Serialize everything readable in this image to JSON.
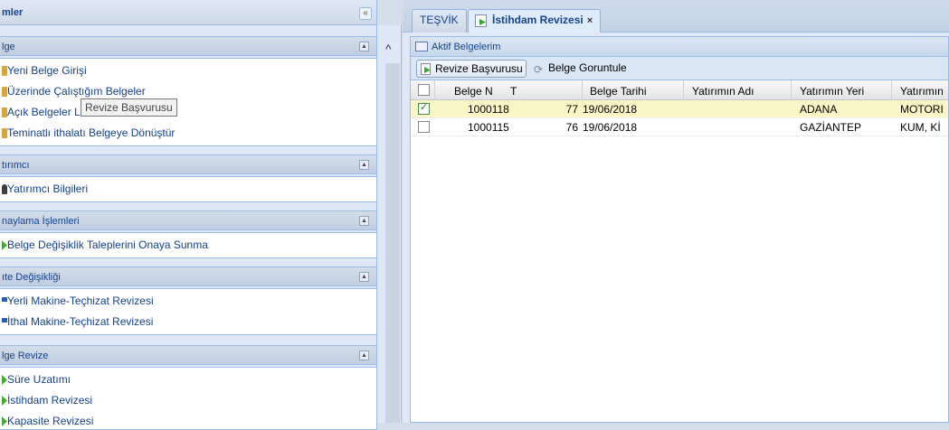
{
  "left_panel": {
    "title": "mler",
    "collapse_icon": "«",
    "groups": [
      {
        "title": "lge",
        "items": [
          {
            "label": "Yeni Belge Girişi",
            "icon": "doc-icon"
          },
          {
            "label": "Üzerinde Çalıştığım Belgeler",
            "icon": "doc-icon"
          },
          {
            "label": "Açık Belgeler Listesi",
            "icon": "doc-icon"
          },
          {
            "label": "Teminatlı ithalatı Belgeye Dönüştür",
            "icon": "doc-icon"
          }
        ]
      },
      {
        "title": "tırımcı",
        "items": [
          {
            "label": "Yatırımcı Bilgileri",
            "icon": "user-icon"
          }
        ]
      },
      {
        "title": "naylama İşlemleri",
        "items": [
          {
            "label": "Belge Değişiklik Taleplerini Onaya Sunma",
            "icon": "green-arrow-icon"
          }
        ]
      },
      {
        "title": "ıte Değişikliği",
        "items": [
          {
            "label": "Yerli Makine-Teçhizat Revizesi",
            "icon": "blue-icon"
          },
          {
            "label": "İthal Makine-Teçhizat Revizesi",
            "icon": "blue-icon"
          }
        ]
      },
      {
        "title": "lge Revize",
        "items": [
          {
            "label": "Süre Uzatımı",
            "icon": "green-arrow-icon"
          },
          {
            "label": "İstihdam Revizesi",
            "icon": "green-arrow-icon"
          },
          {
            "label": "Kapasite Revizesi",
            "icon": "green-arrow-icon"
          }
        ]
      }
    ]
  },
  "tabs": {
    "tesvik": "TEŞVİK",
    "istihdam": "İstihdam Revizesi",
    "close": "×"
  },
  "panel": {
    "title": "Aktif Belgelerim",
    "toolbar": {
      "revize": "Revize Başvurusu",
      "goruntule": "Belge Goruntule"
    },
    "tooltip": "Revize Başvurusu",
    "columns": [
      "Belge N",
      "T",
      "Belge Tarihi",
      "Yatırımın Adı",
      "Yatırımın Yeri",
      "Yatırımın"
    ],
    "rows": [
      {
        "belge": "1000118",
        "no": "77",
        "tarih": "19/06/2018",
        "adi": "",
        "yeri": "ADANA",
        "konu": "MOTORI",
        "checked": true
      },
      {
        "belge": "1000115",
        "no": "76",
        "tarih": "19/06/2018",
        "adi": "",
        "yeri": "GAZİANTEP",
        "konu": "KUM, Kİ",
        "checked": false
      }
    ]
  },
  "colors": {
    "accent": "#15428b",
    "selected_row": "#fbf6c6"
  }
}
